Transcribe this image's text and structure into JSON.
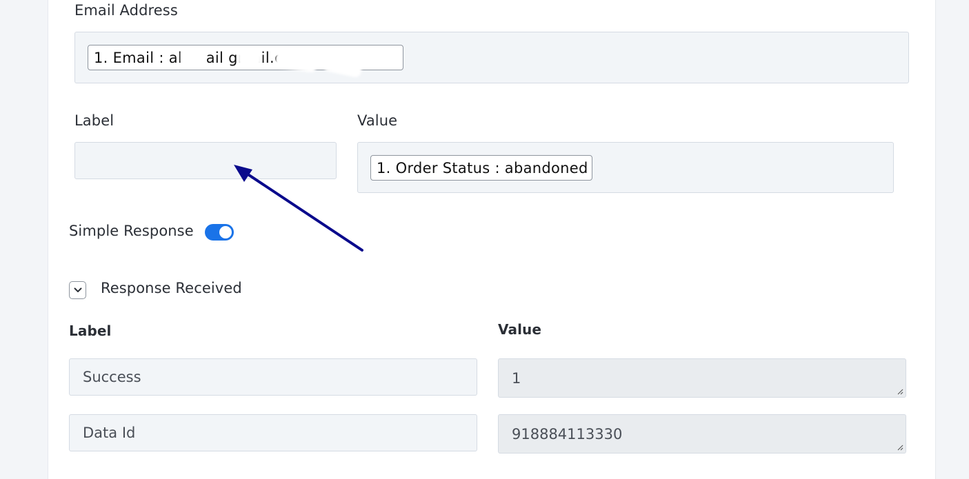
{
  "email_section": {
    "label": "Email Address",
    "tag": "1. Email : al        m   ail      gmail.com"
  },
  "mapping": {
    "label_heading": "Label",
    "value_heading": "Value",
    "label_value": "",
    "value_tag": "1. Order Status : abandoned"
  },
  "simple_response": {
    "label": "Simple Response",
    "enabled": true
  },
  "response_received": {
    "title": "Response Received",
    "label_heading": "Label",
    "value_heading": "Value",
    "rows": [
      {
        "label": "Success",
        "value": "1"
      },
      {
        "label": "Data Id",
        "value": "918884113330"
      }
    ]
  },
  "colors": {
    "toggle_on": "#1a73e8",
    "annotation_arrow": "#0a0a8c"
  }
}
